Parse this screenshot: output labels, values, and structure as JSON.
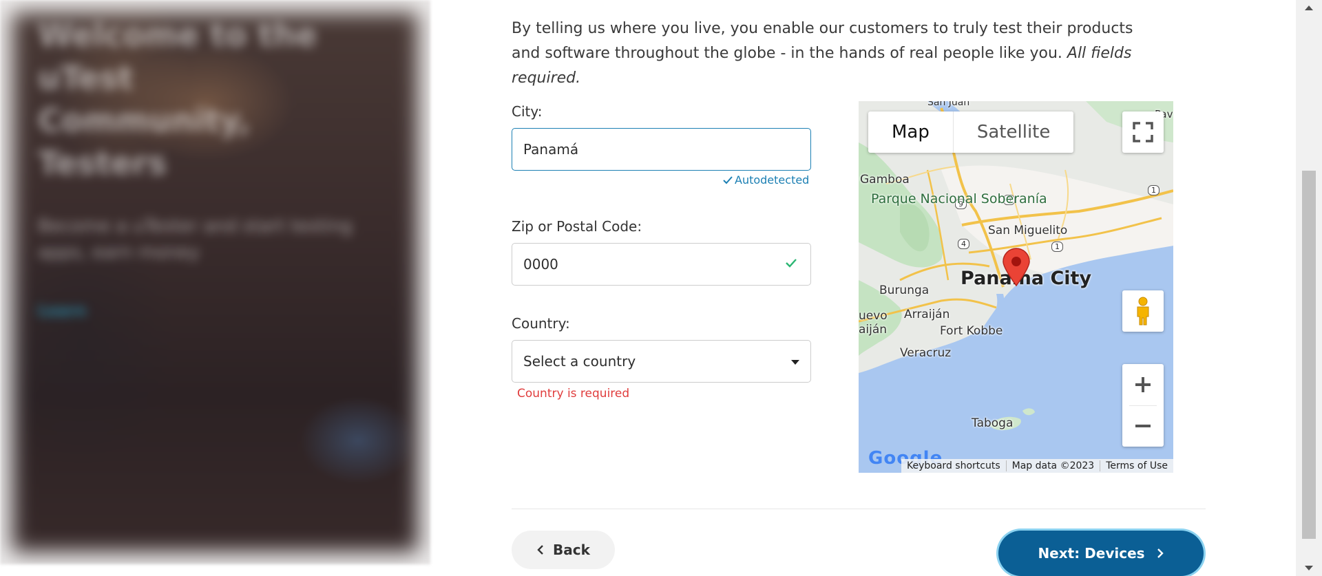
{
  "hero": {
    "title": "Welcome to the uTest Community, Testers",
    "subtitle": "Become a uTester and start testing apps, earn money",
    "link": "Learn"
  },
  "intro": {
    "text": "By telling us where you live, you enable our customers to truly test their products and software throughout the globe - in the hands of real people like you.",
    "required_note": "All fields required."
  },
  "form": {
    "city_label": "City:",
    "city_value": "Panamá",
    "autodetected": "Autodetected",
    "zip_label": "Zip or Postal Code:",
    "zip_value": "0000",
    "country_label": "Country:",
    "country_placeholder": "Select a country",
    "country_error": "Country is required"
  },
  "map": {
    "map_tab": "Map",
    "satellite_tab": "Satellite",
    "labels": {
      "gamboa": "Gamboa",
      "park": "Parque Nacional Soberanía",
      "san_miguelito": "San Miguelito",
      "panama_city": "Panama City",
      "burunga": "Burunga",
      "arraijan": "Arraiján",
      "nuevo": "uevo",
      "arraijan2": "aiján",
      "fort_kobbe": "Fort Kobbe",
      "veracruz": "Veracruz",
      "taboga": "Taboga",
      "san_juan": "San Juan",
      "pav": "Pav"
    },
    "route_badges": [
      "9",
      "3",
      "4",
      "1",
      "1"
    ],
    "footer": {
      "shortcuts": "Keyboard shortcuts",
      "data": "Map data ©2023",
      "terms": "Terms of Use"
    },
    "logo": "Google"
  },
  "nav": {
    "back": "Back",
    "next": "Next: Devices"
  },
  "colors": {
    "accent": "#1b7fb3",
    "primary_button": "#0b5f95",
    "error": "#e03c3c",
    "success": "#2bb673"
  }
}
